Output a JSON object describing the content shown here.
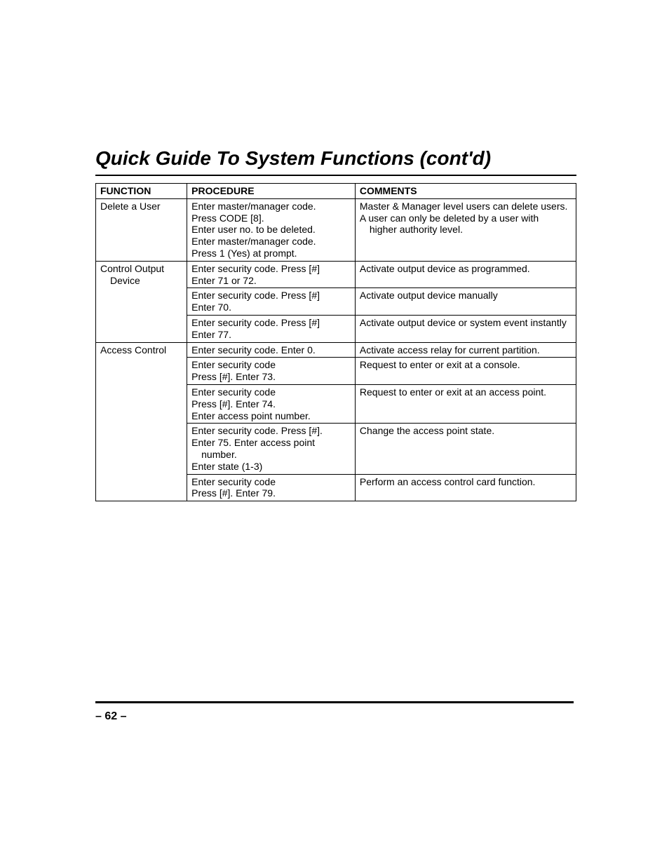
{
  "title": "Quick Guide To System Functions (cont'd)",
  "headers": {
    "fn": "FUNCTION",
    "proc": "PROCEDURE",
    "comm": "COMMENTS"
  },
  "rows": [
    {
      "fn": "Delete a User",
      "proc": "Enter master/manager code.\nPress CODE [8].\nEnter user no. to be deleted.\nEnter master/manager code.\nPress 1 (Yes) at prompt.",
      "comm": "Master & Manager level users can delete users.\nA user can only be deleted by a user with",
      "comm2": "higher authority level.",
      "fnRowspan": 1
    },
    {
      "fn": "Control Output",
      "fn2": "Device",
      "proc": "Enter security code.  Press [#]\nEnter 71 or 72.",
      "comm": "Activate output device as programmed.",
      "fnRowspan": 3
    },
    {
      "proc": "Enter security code.  Press [#]\nEnter 70.",
      "comm": "Activate output device manually"
    },
    {
      "proc": "Enter security code.  Press [#]\nEnter 77.",
      "comm": "Activate output device or system event instantly"
    },
    {
      "fn": "Access Control",
      "proc": "Enter security code.  Enter 0.",
      "comm": "Activate access relay for current partition.",
      "fnRowspan": 5
    },
    {
      "proc": "Enter security code\nPress [#].  Enter 73.\n ",
      "comm": "Request to enter or exit at a console."
    },
    {
      "proc": "Enter security code\nPress [#].  Enter 74.\nEnter access point number.\n ",
      "comm": "Request to enter or exit at an access point."
    },
    {
      "proc": "Enter security code.  Press [#].\nEnter 75.  Enter access point",
      "proc2": "number.",
      "proc3": "Enter state (1-3)",
      "comm": "Change the access point state."
    },
    {
      "proc": "Enter security code\nPress [#].  Enter 79.",
      "comm": "Perform an access control card function."
    }
  ],
  "pageNum": "– 62 –"
}
